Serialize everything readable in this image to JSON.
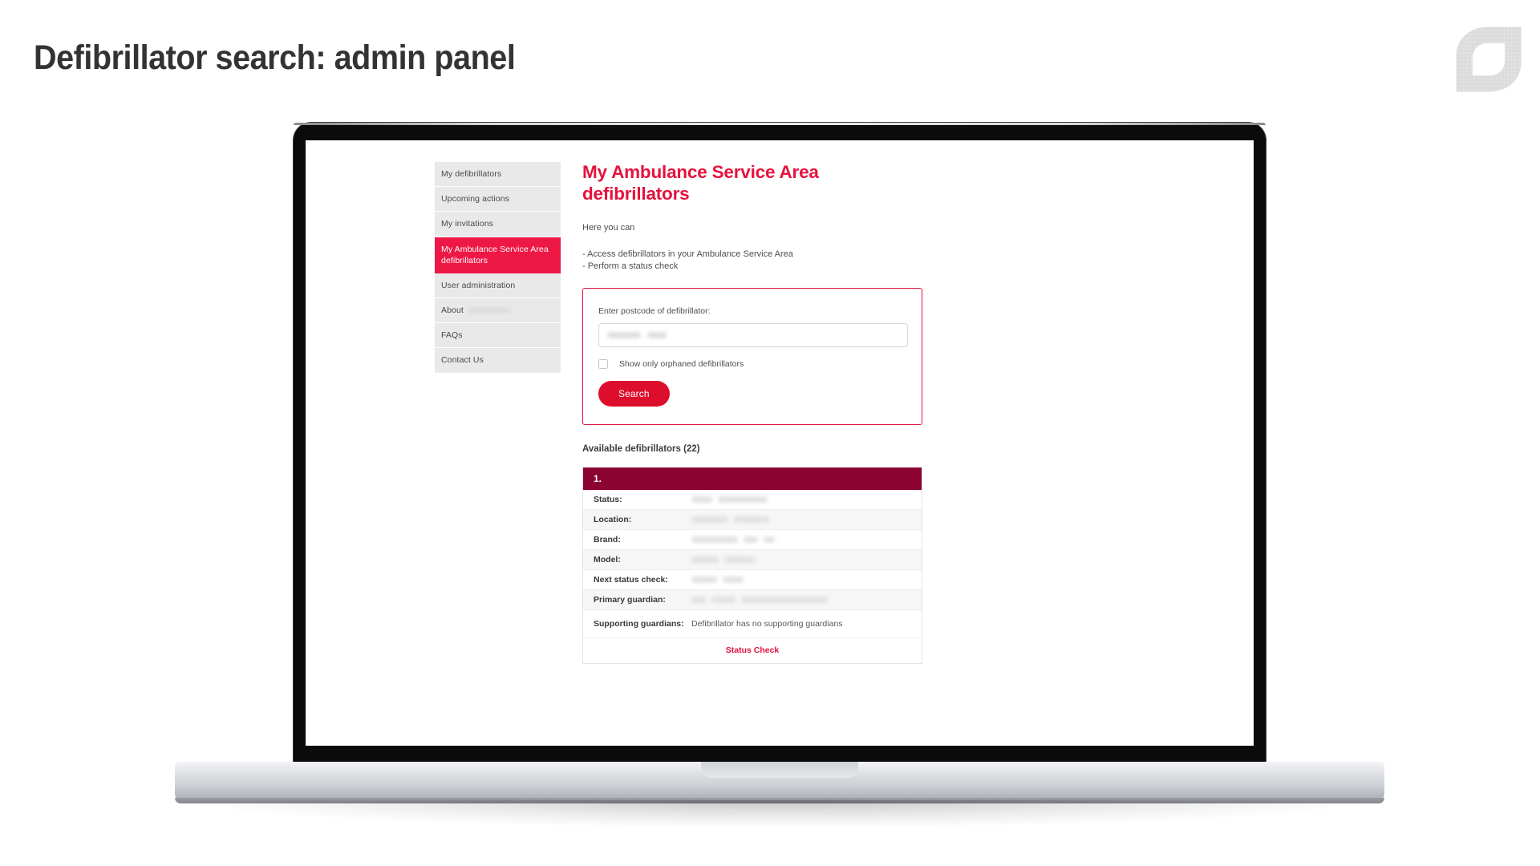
{
  "slide": {
    "title": "Defibrillator search: admin panel",
    "logo_name": "leaf-logo"
  },
  "colors": {
    "accent_red": "#ED1846",
    "heading_red": "#E6123D",
    "button_red": "#DD0D2C",
    "card_maroon": "#8B0330",
    "sidebar_bg": "#E9E9E9",
    "title_gray": "#333333"
  },
  "sidebar": {
    "items": [
      {
        "label": "My defibrillators",
        "active": false,
        "redacted_suffix": false
      },
      {
        "label": "Upcoming actions",
        "active": false,
        "redacted_suffix": false
      },
      {
        "label": "My invitations",
        "active": false,
        "redacted_suffix": false
      },
      {
        "label": "My Ambulance Service Area defibrillators",
        "active": true,
        "redacted_suffix": false
      },
      {
        "label": "User administration",
        "active": false,
        "redacted_suffix": false
      },
      {
        "label": "About",
        "active": false,
        "redacted_suffix": true
      },
      {
        "label": "FAQs",
        "active": false,
        "redacted_suffix": false
      },
      {
        "label": "Contact Us",
        "active": false,
        "redacted_suffix": false
      }
    ]
  },
  "main": {
    "heading": "My Ambulance Service Area defibrillators",
    "intro": "Here you can",
    "bullets": [
      "- Access defibrillators in your Ambulance Service Area",
      "- Perform a status check"
    ],
    "search": {
      "label": "Enter postcode of defibrillator:",
      "input_value": "",
      "input_placeholder": "",
      "placeholder_redacted": true,
      "checkbox_label": "Show only orphaned defibrillators",
      "checkbox_checked": false,
      "button_label": "Search"
    },
    "results": {
      "title": "Available defibrillators (22)",
      "count": 22,
      "card": {
        "index_label": "1.",
        "rows": [
          {
            "key": "Status:",
            "value": "",
            "redacted": true,
            "redact_widths": [
              26,
              62
            ]
          },
          {
            "key": "Location:",
            "value": "",
            "redacted": true,
            "redact_widths": [
              46,
              44
            ]
          },
          {
            "key": "Brand:",
            "value": "",
            "redacted": true,
            "redact_widths": [
              58,
              18,
              14
            ]
          },
          {
            "key": "Model:",
            "value": "",
            "redacted": true,
            "redact_widths": [
              34,
              38
            ]
          },
          {
            "key": "Next status check:",
            "value": "",
            "redacted": true,
            "redact_widths": [
              32,
              26
            ]
          },
          {
            "key": "Primary guardian:",
            "value": "",
            "redacted": true,
            "redact_widths": [
              18,
              30,
              108
            ]
          },
          {
            "key": "Supporting guardians:",
            "value": "Defibrillator has no supporting guardians",
            "redacted": false,
            "redact_widths": []
          }
        ],
        "footer_action": "Status Check"
      }
    }
  }
}
